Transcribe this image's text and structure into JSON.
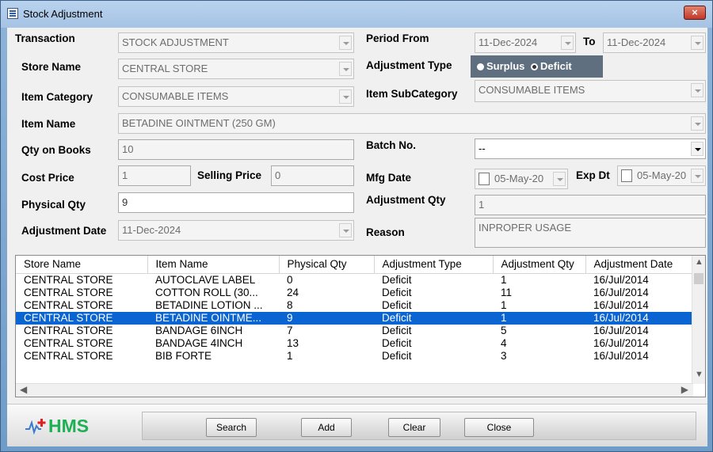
{
  "window": {
    "title": "Stock Adjustment",
    "close_glyph": "×"
  },
  "form": {
    "transaction_label": "Transaction",
    "transaction_value": "STOCK ADJUSTMENT",
    "period_from_label": "Period From",
    "period_from_value": "11-Dec-2024",
    "to_label": "To",
    "to_value": "11-Dec-2024",
    "store_name_label": "Store Name",
    "store_name_value": "CENTRAL STORE",
    "adjustment_type_label": "Adjustment Type",
    "surplus_label": "Surplus",
    "deficit_label": "Deficit",
    "item_category_label": "Item Category",
    "item_category_value": "CONSUMABLE ITEMS",
    "item_subcategory_label": "Item SubCategory",
    "item_subcategory_value": "CONSUMABLE ITEMS",
    "item_name_label": "Item Name",
    "item_name_value": "BETADINE OINTMENT (250 GM)",
    "qty_on_books_label": "Qty on Books",
    "qty_on_books_value": "10",
    "batch_no_label": "Batch No.",
    "batch_no_value": "--",
    "cost_price_label": "Cost Price",
    "cost_price_value": "1",
    "selling_price_label": "Selling Price",
    "selling_price_value": "0",
    "mfg_date_label": "Mfg Date",
    "mfg_date_value": "05-May-20",
    "exp_dt_label": "Exp Dt",
    "exp_dt_value": "05-May-20",
    "physical_qty_label": "Physical Qty",
    "physical_qty_value": "9",
    "adjustment_qty_label": "Adjustment Qty",
    "adjustment_qty_value": "1",
    "adjustment_date_label": "Adjustment Date",
    "adjustment_date_value": "11-Dec-2024",
    "reason_label": "Reason",
    "reason_value": "INPROPER USAGE"
  },
  "grid": {
    "columns": [
      "Store Name",
      "Item Name",
      "Physical Qty",
      "Adjustment Type",
      "Adjustment Qty",
      "Adjustment Date"
    ],
    "rows": [
      [
        "CENTRAL STORE",
        "AUTOCLAVE LABEL",
        "0",
        "Deficit",
        "1",
        "16/Jul/2014"
      ],
      [
        "CENTRAL STORE",
        "COTTON ROLL (30...",
        "24",
        "Deficit",
        "11",
        "16/Jul/2014"
      ],
      [
        "CENTRAL STORE",
        "BETADINE LOTION ...",
        "8",
        "Deficit",
        "1",
        "16/Jul/2014"
      ],
      [
        "CENTRAL STORE",
        "BETADINE OINTME...",
        "9",
        "Deficit",
        "1",
        "16/Jul/2014"
      ],
      [
        "CENTRAL STORE",
        "BANDAGE 6INCH",
        "7",
        "Deficit",
        "5",
        "16/Jul/2014"
      ],
      [
        "CENTRAL STORE",
        "BANDAGE 4INCH",
        "13",
        "Deficit",
        "4",
        "16/Jul/2014"
      ],
      [
        "CENTRAL STORE",
        "BIB FORTE",
        "1",
        "Deficit",
        "3",
        "16/Jul/2014"
      ]
    ],
    "selected_row": 3
  },
  "logo": {
    "text": "HMS"
  },
  "buttons": {
    "search": "Search",
    "add": "Add",
    "clear": "Clear",
    "close": "Close"
  }
}
